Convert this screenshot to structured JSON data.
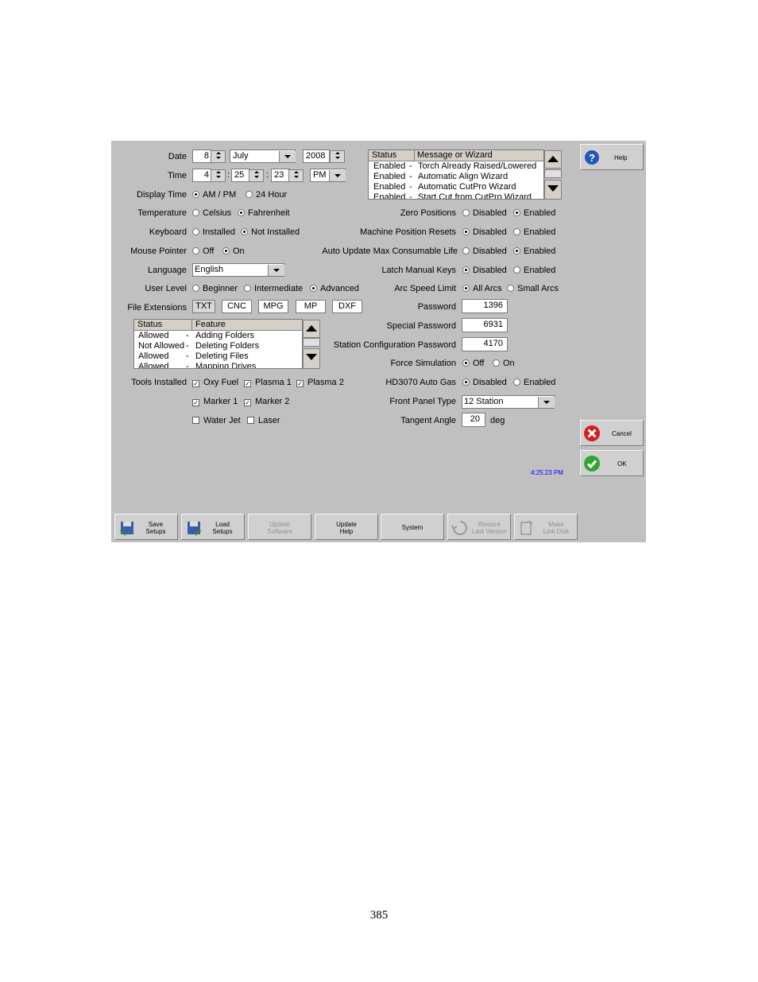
{
  "date": {
    "label": "Date",
    "day": "8",
    "month": "July",
    "year": "2008"
  },
  "time": {
    "label": "Time",
    "hour": "4",
    "minute": "25",
    "second": "23",
    "ampm": "PM"
  },
  "display_time": {
    "label": "Display Time",
    "opt1": "AM / PM",
    "opt2": "24 Hour"
  },
  "temperature": {
    "label": "Temperature",
    "opt1": "Celsius",
    "opt2": "Fahrenheit"
  },
  "keyboard": {
    "label": "Keyboard",
    "opt1": "Installed",
    "opt2": "Not Installed"
  },
  "mouse_pointer": {
    "label": "Mouse Pointer",
    "opt1": "Off",
    "opt2": "On"
  },
  "language": {
    "label": "Language",
    "value": "English"
  },
  "user_level": {
    "label": "User Level",
    "opt1": "Beginner",
    "opt2": "Intermediate",
    "opt3": "Advanced"
  },
  "file_ext": {
    "label": "File Extensions",
    "items": [
      "TXT",
      "CNC",
      "MPG",
      "MP",
      "DXF"
    ]
  },
  "features": {
    "col_status": "Status",
    "col_feature": "Feature",
    "rows": [
      {
        "status": "Allowed",
        "sep": "-",
        "feature": "Adding Folders"
      },
      {
        "status": "Not Allowed",
        "sep": "-",
        "feature": "Deleting Folders"
      },
      {
        "status": "Allowed",
        "sep": "-",
        "feature": "Deleting Files"
      },
      {
        "status": "Allowed",
        "sep": "-",
        "feature": "Mapping Drives"
      }
    ]
  },
  "tools": {
    "label": "Tools Installed",
    "oxy": "Oxy Fuel",
    "plasma1": "Plasma 1",
    "plasma2": "Plasma 2",
    "marker1": "Marker 1",
    "marker2": "Marker 2",
    "waterjet": "Water Jet",
    "laser": "Laser"
  },
  "wizards": {
    "col_status": "Status",
    "col_msg": "Message or Wizard",
    "rows": [
      {
        "status": "Enabled",
        "sep": "-",
        "msg": "Torch Already Raised/Lowered"
      },
      {
        "status": "Enabled",
        "sep": "-",
        "msg": "Automatic Align Wizard"
      },
      {
        "status": "Enabled",
        "sep": "-",
        "msg": "Automatic CutPro Wizard"
      },
      {
        "status": "Enabled",
        "sep": "-",
        "msg": "Start Cut from CutPro Wizard"
      }
    ]
  },
  "right": {
    "zero_positions": "Zero Positions",
    "machine_resets": "Machine Position Resets",
    "auto_update": "Auto Update Max Consumable Life",
    "latch_keys": "Latch Manual Keys",
    "arc_speed": "Arc Speed Limit",
    "arc_all": "All Arcs",
    "arc_small": "Small Arcs",
    "disabled": "Disabled",
    "enabled": "Enabled",
    "password_label": "Password",
    "password": "1396",
    "special_label": "Special Password",
    "special": "6931",
    "station_label": "Station Configuration Password",
    "station": "4170",
    "force_sim": "Force Simulation",
    "off": "Off",
    "on": "On",
    "hd3070": "HD3070 Auto Gas",
    "front_panel_label": "Front Panel Type",
    "front_panel": "12 Station",
    "tangent_label": "Tangent Angle",
    "tangent": "20",
    "deg": "deg"
  },
  "clock": "4:25:23 PM",
  "side_buttons": {
    "help": "Help",
    "cancel": "Cancel",
    "ok": "OK"
  },
  "bottom": {
    "save1": "Save",
    "save2": "Setups",
    "load1": "Load",
    "load2": "Setups",
    "upsw1": "Update",
    "upsw2": "Software",
    "uphelp1": "Update",
    "uphelp2": "Help",
    "system": "System",
    "restore1": "Restore",
    "restore2": "Last Version",
    "make1": "Make",
    "make2": "Link Disk"
  },
  "page_number": "385",
  "colors": {
    "panel": "#c0c0c0",
    "clock": "#0000ff"
  }
}
